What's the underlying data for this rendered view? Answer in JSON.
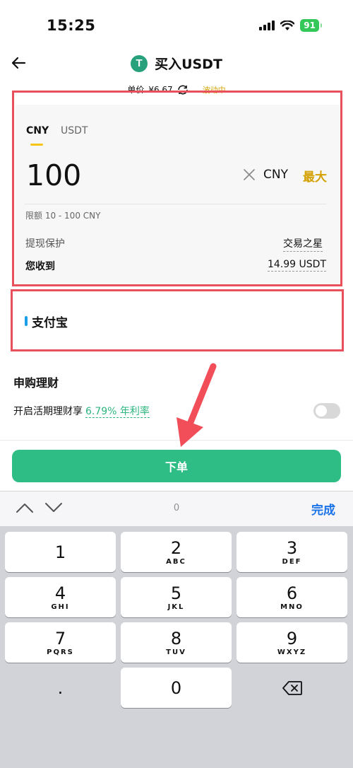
{
  "status_bar": {
    "time": "15:25",
    "battery": "91"
  },
  "header": {
    "title": "买入USDT",
    "logo_glyph": "T"
  },
  "price": {
    "label": "单价",
    "value": "¥6.67",
    "status": "波动中"
  },
  "amount_card": {
    "tabs": [
      "CNY",
      "USDT"
    ],
    "selected_tab": "CNY",
    "amount": "100",
    "currency": "CNY",
    "max_label": "最大",
    "limit_text": "限额 10 - 100 CNY",
    "protection_label": "提现保护",
    "protection_value": "交易之星",
    "receive_label": "您收到",
    "receive_value": "14.99 USDT"
  },
  "payment": {
    "method": "支付宝",
    "indicator_color": "#1a9ee8"
  },
  "earn": {
    "title": "申购理财",
    "toggle_text": "开启活期理财享",
    "rate_text": "6.79% 年利率",
    "toggle_on": false
  },
  "order_button": {
    "label": "下单",
    "color": "#2ebd85"
  },
  "keyboard_accessory": {
    "value": "0",
    "done_label": "完成"
  },
  "keypad": {
    "keys": [
      {
        "num": "1",
        "letters": ""
      },
      {
        "num": "2",
        "letters": "ABC"
      },
      {
        "num": "3",
        "letters": "DEF"
      },
      {
        "num": "4",
        "letters": "GHI"
      },
      {
        "num": "5",
        "letters": "JKL"
      },
      {
        "num": "6",
        "letters": "MNO"
      },
      {
        "num": "7",
        "letters": "PQRS"
      },
      {
        "num": "8",
        "letters": "TUV"
      },
      {
        "num": "9",
        "letters": "WXYZ"
      }
    ],
    "dot": ".",
    "zero": "0"
  },
  "colors": {
    "accent_yellow": "#f5c518",
    "max_gold": "#d4a100",
    "highlight_red": "#e8505b",
    "rate_green": "#2cb57f"
  }
}
